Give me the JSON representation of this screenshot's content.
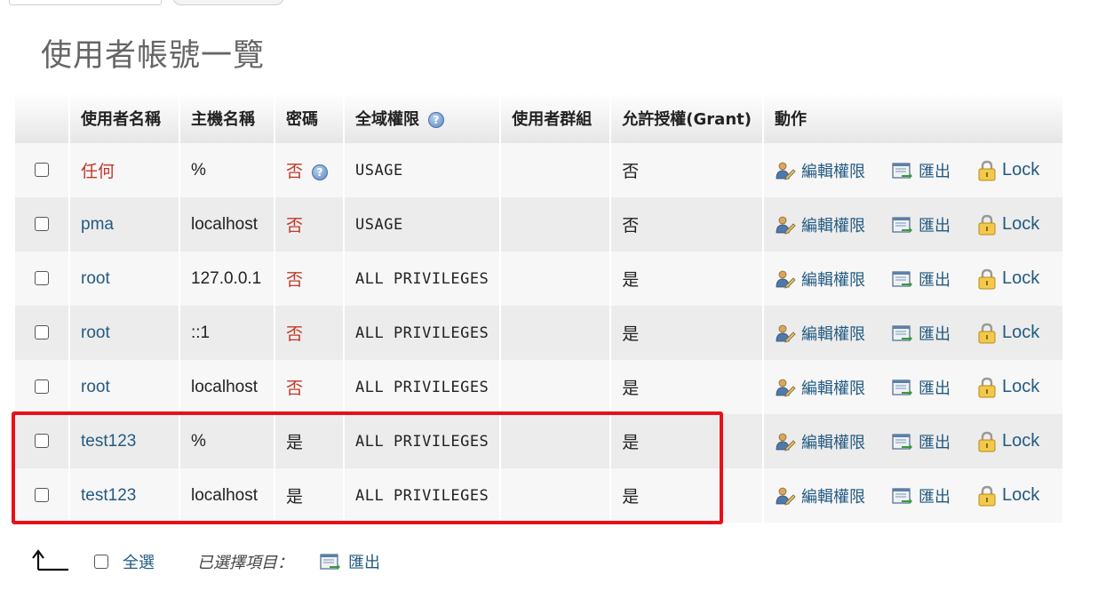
{
  "page": {
    "title": "使用者帳號一覽"
  },
  "columns": {
    "user_name": "使用者名稱",
    "host_name": "主機名稱",
    "password": "密碼",
    "global_privileges": "全域權限",
    "user_group": "使用者群組",
    "grant": "允許授權(Grant)",
    "action": "動作"
  },
  "rows": [
    {
      "user": "任何",
      "host": "%",
      "password": "否",
      "privileges": "USAGE",
      "group": "",
      "grant": "否",
      "edit": "編輯權限",
      "export": "匯出",
      "lock": "Lock"
    },
    {
      "user": "pma",
      "host": "localhost",
      "password": "否",
      "privileges": "USAGE",
      "group": "",
      "grant": "否",
      "edit": "編輯權限",
      "export": "匯出",
      "lock": "Lock"
    },
    {
      "user": "root",
      "host": "127.0.0.1",
      "password": "否",
      "privileges": "ALL PRIVILEGES",
      "group": "",
      "grant": "是",
      "edit": "編輯權限",
      "export": "匯出",
      "lock": "Lock"
    },
    {
      "user": "root",
      "host": "::1",
      "password": "否",
      "privileges": "ALL PRIVILEGES",
      "group": "",
      "grant": "是",
      "edit": "編輯權限",
      "export": "匯出",
      "lock": "Lock"
    },
    {
      "user": "root",
      "host": "localhost",
      "password": "否",
      "privileges": "ALL PRIVILEGES",
      "group": "",
      "grant": "是",
      "edit": "編輯權限",
      "export": "匯出",
      "lock": "Lock"
    },
    {
      "user": "test123",
      "host": "%",
      "password": "是",
      "privileges": "ALL PRIVILEGES",
      "group": "",
      "grant": "是",
      "edit": "編輯權限",
      "export": "匯出",
      "lock": "Lock"
    },
    {
      "user": "test123",
      "host": "localhost",
      "password": "是",
      "privileges": "ALL PRIVILEGES",
      "group": "",
      "grant": "是",
      "edit": "編輯權限",
      "export": "匯出",
      "lock": "Lock"
    }
  ],
  "footer": {
    "select_all": "全選",
    "with_selected": "已選擇項目：",
    "export": "匯出"
  },
  "icons": {
    "help": "help-icon",
    "edit": "edit-privileges-icon",
    "export": "export-icon",
    "lock": "lock-icon",
    "arrow": "arrow-left-up-icon"
  },
  "colors": {
    "link": "#235a81",
    "no_password": "#c0392b",
    "highlight": "#e8101a"
  }
}
